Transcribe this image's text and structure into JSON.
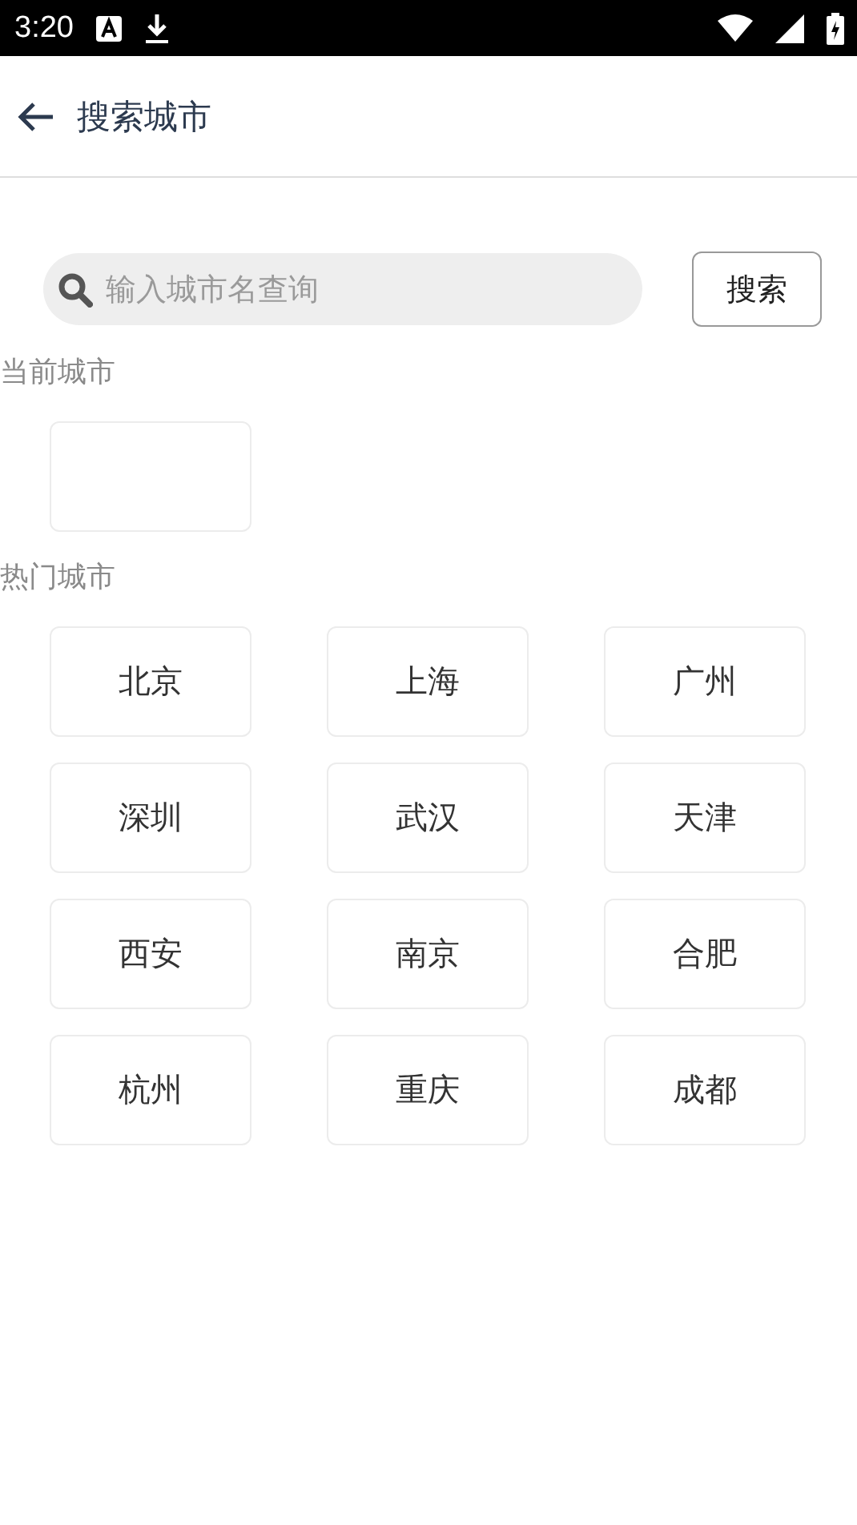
{
  "status_bar": {
    "time": "3:20"
  },
  "header": {
    "title": "搜索城市"
  },
  "search": {
    "placeholder": "输入城市名查询",
    "button": "搜索"
  },
  "current_section": {
    "label": "当前城市"
  },
  "hot_section": {
    "label": "热门城市",
    "cities": [
      "北京",
      "上海",
      "广州",
      "深圳",
      "武汉",
      "天津",
      "西安",
      "南京",
      "合肥",
      "杭州",
      "重庆",
      "成都"
    ]
  }
}
